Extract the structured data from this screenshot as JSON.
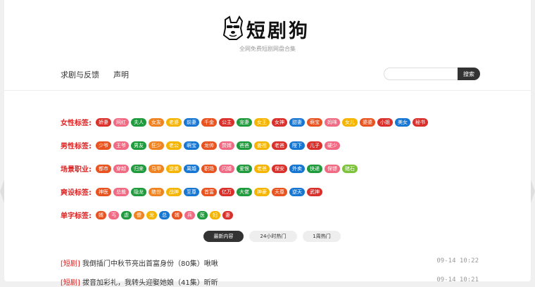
{
  "header": {
    "logo_text": "短剧狗",
    "subtitle": "全网免费短剧网盘合集"
  },
  "nav": {
    "items": [
      "求剧与反馈",
      "声明"
    ]
  },
  "search": {
    "placeholder": "",
    "button_label": "搜索"
  },
  "tag_sections": [
    {
      "label": "女性标签:",
      "tags": [
        {
          "text": "娇妻",
          "color": "#d9302b"
        },
        {
          "text": "网红",
          "color": "#ef6a82"
        },
        {
          "text": "夫人",
          "color": "#1f9a3c"
        },
        {
          "text": "女友",
          "color": "#ef8322"
        },
        {
          "text": "老婆",
          "color": "#f5b400"
        },
        {
          "text": "前妻",
          "color": "#1676d2"
        },
        {
          "text": "千金",
          "color": "#e8531f"
        },
        {
          "text": "公主",
          "color": "#d9302b"
        },
        {
          "text": "宠妻",
          "color": "#1f9a3c"
        },
        {
          "text": "女王",
          "color": "#f5b400"
        },
        {
          "text": "女神",
          "color": "#d9302b"
        },
        {
          "text": "甜妻",
          "color": "#1676d2"
        },
        {
          "text": "萌宝",
          "color": "#e8531f"
        },
        {
          "text": "妈咪",
          "color": "#ef6a82"
        },
        {
          "text": "女儿",
          "color": "#f5b400"
        },
        {
          "text": "婆婆",
          "color": "#e8531f"
        },
        {
          "text": "小姐",
          "color": "#d9302b"
        },
        {
          "text": "美女",
          "color": "#1676d2"
        },
        {
          "text": "秘书",
          "color": "#d9302b"
        }
      ]
    },
    {
      "label": "男性标签:",
      "tags": [
        {
          "text": "少爷",
          "color": "#e8531f"
        },
        {
          "text": "王爷",
          "color": "#ef6a82"
        },
        {
          "text": "男友",
          "color": "#1f9a3c"
        },
        {
          "text": "狂少",
          "color": "#ef8322"
        },
        {
          "text": "老公",
          "color": "#f5b400"
        },
        {
          "text": "萌宝",
          "color": "#1676d2"
        },
        {
          "text": "龙帅",
          "color": "#e8531f"
        },
        {
          "text": "赘婿",
          "color": "#ef6a82"
        },
        {
          "text": "爸爸",
          "color": "#1f9a3c"
        },
        {
          "text": "姜祖",
          "color": "#f5b400"
        },
        {
          "text": "老爸",
          "color": "#d9302b"
        },
        {
          "text": "陛下",
          "color": "#1676d2"
        },
        {
          "text": "儿子",
          "color": "#d9302b"
        },
        {
          "text": "硬少",
          "color": "#ef6a82"
        }
      ]
    },
    {
      "label": "场景职业:",
      "tags": [
        {
          "text": "都市",
          "color": "#e8531f"
        },
        {
          "text": "穿越",
          "color": "#ef6a82"
        },
        {
          "text": "归来",
          "color": "#1f9a3c"
        },
        {
          "text": "马甲",
          "color": "#ef8322"
        },
        {
          "text": "逆袭",
          "color": "#f5b400"
        },
        {
          "text": "离婚",
          "color": "#1676d2"
        },
        {
          "text": "职场",
          "color": "#e8531f"
        },
        {
          "text": "闪婚",
          "color": "#ef6a82"
        },
        {
          "text": "爱恨",
          "color": "#1f9a3c"
        },
        {
          "text": "老爸",
          "color": "#f5b400"
        },
        {
          "text": "保安",
          "color": "#d9302b"
        },
        {
          "text": "外卖",
          "color": "#1676d2"
        },
        {
          "text": "快递",
          "color": "#1f9a3c"
        },
        {
          "text": "保镖",
          "color": "#ef6a82"
        },
        {
          "text": "赌石",
          "color": "#7cc33a"
        }
      ]
    },
    {
      "label": "爽设标签:",
      "tags": [
        {
          "text": "神医",
          "color": "#e8531f"
        },
        {
          "text": "总裁",
          "color": "#ef6a82"
        },
        {
          "text": "隐龙",
          "color": "#1f9a3c"
        },
        {
          "text": "绝世",
          "color": "#ef8322"
        },
        {
          "text": "战神",
          "color": "#f5b400"
        },
        {
          "text": "至尊",
          "color": "#1676d2"
        },
        {
          "text": "首富",
          "color": "#e8531f"
        },
        {
          "text": "亿万",
          "color": "#d9302b"
        },
        {
          "text": "大佬",
          "color": "#1f9a3c"
        },
        {
          "text": "神豪",
          "color": "#f5b400"
        },
        {
          "text": "天尊",
          "color": "#e8531f"
        },
        {
          "text": "逆天",
          "color": "#1676d2"
        },
        {
          "text": "武神",
          "color": "#d9302b"
        }
      ]
    },
    {
      "label": "单字标签:",
      "tags": [
        {
          "text": "婿",
          "color": "#e8531f"
        },
        {
          "text": "丐",
          "color": "#ef6a82"
        },
        {
          "text": "虐",
          "color": "#1f9a3c"
        },
        {
          "text": "傻",
          "color": "#ef8322"
        },
        {
          "text": "龙",
          "color": "#f5b400"
        },
        {
          "text": "总",
          "color": "#1676d2"
        },
        {
          "text": "婿",
          "color": "#e8531f"
        },
        {
          "text": "兵",
          "color": "#ef6a82"
        },
        {
          "text": "医",
          "color": "#1f9a3c"
        },
        {
          "text": "妇",
          "color": "#f5b400"
        },
        {
          "text": "妻",
          "color": "#d9302b"
        }
      ]
    }
  ],
  "tabs": [
    "最新内容",
    "24小时热门",
    "1周热门"
  ],
  "list": [
    {
      "badge": "[短剧]",
      "title": "我倒插门中秋节亮出首富身份（80集）啾啾",
      "time": "09-14 10:22"
    },
    {
      "badge": "[短剧]",
      "title": "拔音加彩礼，我转头迎娶她娘（41集）昕昕",
      "time": "09-14 10:21"
    }
  ]
}
